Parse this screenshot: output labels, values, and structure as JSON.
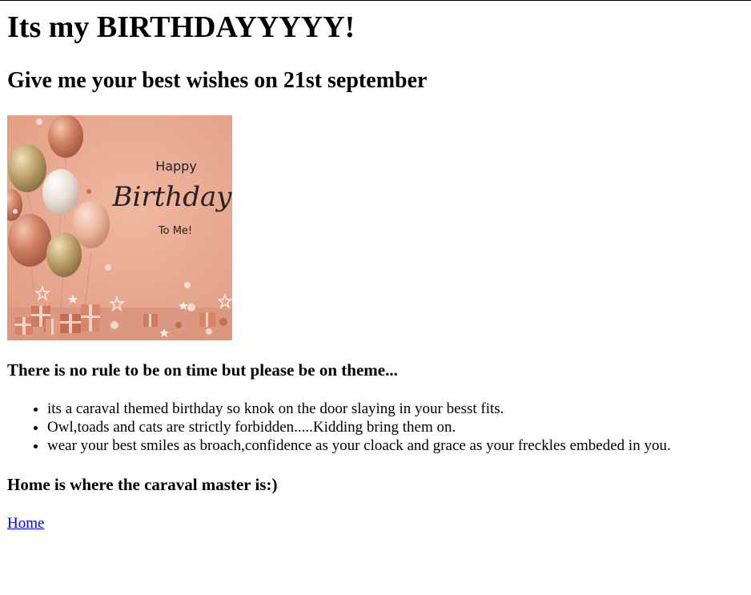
{
  "page": {
    "title": "Its my BIRTHDAYYYYY!",
    "subtitle": "Give me your best wishes on 21st september"
  },
  "banner": {
    "line1": "Happy",
    "line2": "Birthday",
    "line3": "To Me!",
    "colors": {
      "background": "#e9a990",
      "floor": "#dc9a82",
      "balloon_rose": "#c9785c",
      "balloon_gold": "#b89c66",
      "balloon_white": "#ece4dc",
      "gift": "#d8836a",
      "text": "#222222"
    }
  },
  "theme_section": {
    "heading": "There is no rule to be on time but please be on theme...",
    "items": [
      "its a caraval themed birthday so knok on the door slaying in your besst fits.",
      "Owl,toads and cats are strictly forbidden.....Kidding bring them on.",
      "wear your best smiles as broach,confidence as your cloack and grace as your freckles embeded in you."
    ]
  },
  "home_section": {
    "heading": "Home is where the caraval master is:)",
    "link_label": "Home"
  },
  "colors": {
    "link": "#0000ee",
    "text": "#000000",
    "background": "#ffffff"
  }
}
